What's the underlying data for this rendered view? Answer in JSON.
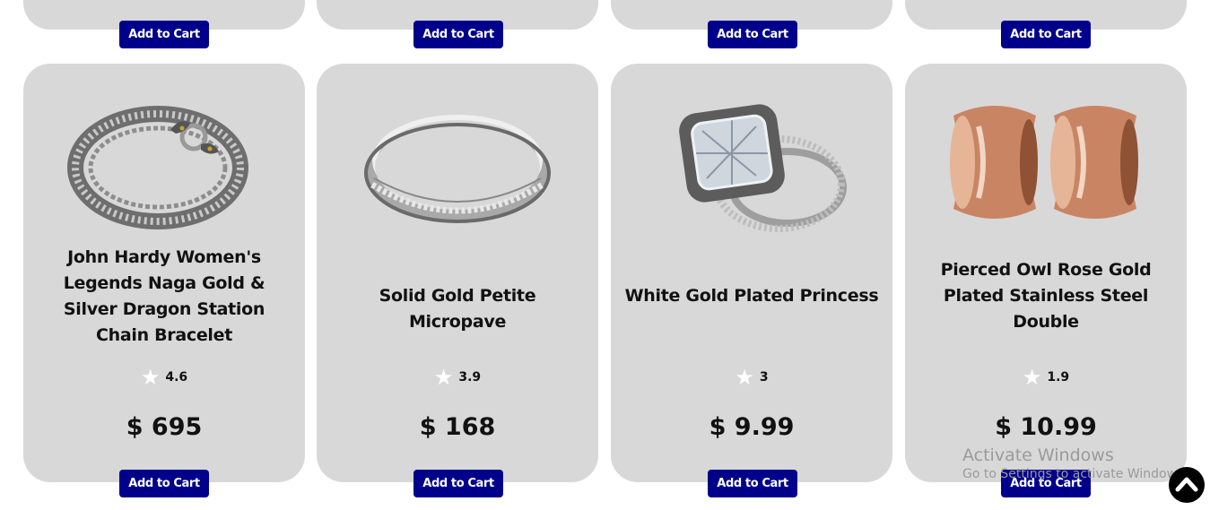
{
  "top_row": [
    {
      "button_label": "Add to Cart"
    },
    {
      "button_label": "Add to Cart"
    },
    {
      "button_label": "Add to Cart"
    },
    {
      "button_label": "Add to Cart"
    }
  ],
  "products": [
    {
      "title": "John Hardy Women's Legends Naga Gold & Silver Dragon Station Chain Bracelet",
      "rating": "4.6",
      "price": "$ 695",
      "button_label": "Add to Cart",
      "image": "silver-dragon-bracelet"
    },
    {
      "title": "Solid Gold Petite Micropave",
      "rating": "3.9",
      "price": "$ 168",
      "button_label": "Add to Cart",
      "image": "white-gold-band-ring"
    },
    {
      "title": "White Gold Plated Princess",
      "rating": "3",
      "price": "$ 9.99",
      "button_label": "Add to Cart",
      "image": "princess-cut-ring-set"
    },
    {
      "title": "Pierced Owl Rose Gold Plated Stainless Steel Double",
      "rating": "1.9",
      "price": "$ 10.99",
      "button_label": "Add to Cart",
      "image": "rose-gold-tunnel-earrings"
    }
  ],
  "watermark": {
    "line1": "Activate Windows",
    "line2": "Go to Settings to activate Windows."
  },
  "icons": {
    "star": "star-icon",
    "scroll_top": "chevron-up-icon"
  },
  "colors": {
    "card_bg": "#d9d8d8",
    "button_bg": "#00008b",
    "button_text": "#ffffff"
  }
}
